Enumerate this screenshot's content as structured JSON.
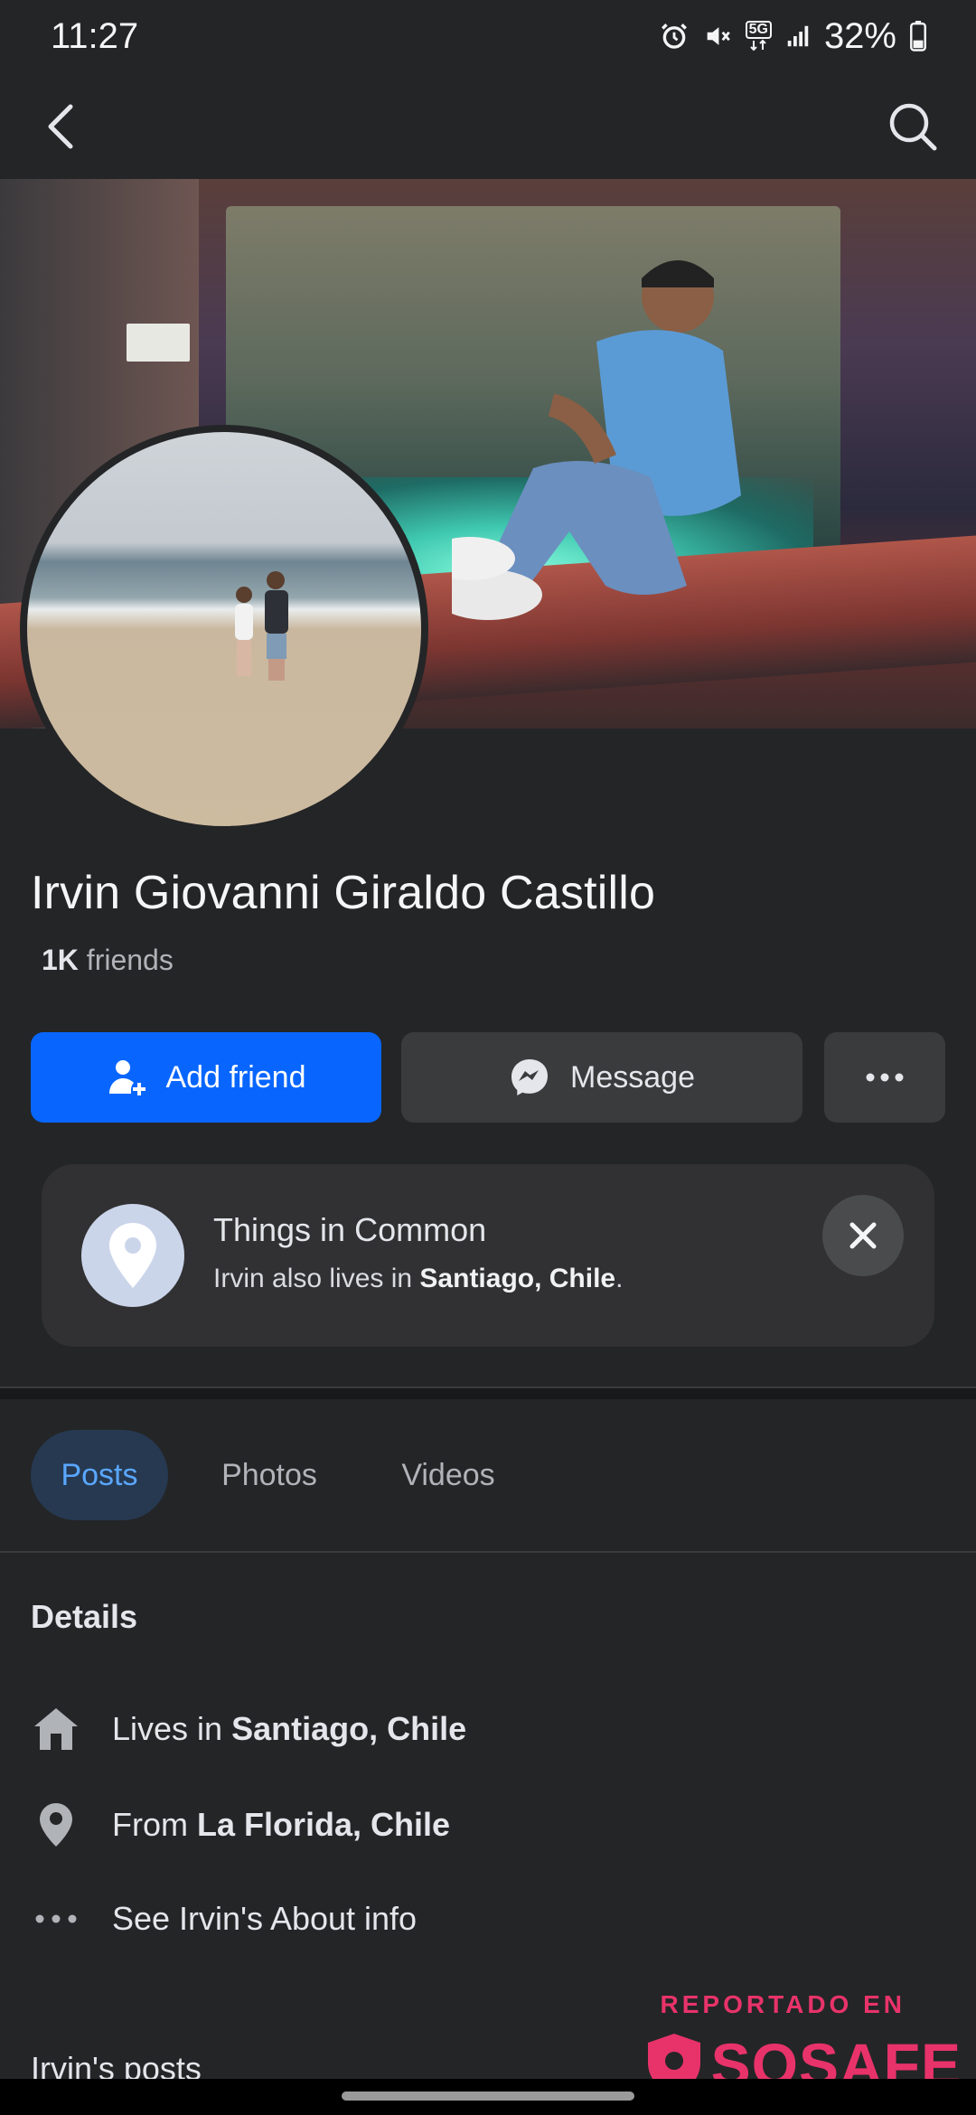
{
  "status_bar": {
    "time": "11:27",
    "network": "5G",
    "battery": "32%"
  },
  "nav": {
    "back_icon": "chevron-left-icon",
    "search_icon": "search-icon"
  },
  "profile": {
    "name": "Irvin Giovanni Giraldo Castillo",
    "friends_count": "1K",
    "friends_label": "friends"
  },
  "actions": {
    "add_friend": "Add friend",
    "message": "Message",
    "more_icon": "more-horizontal-icon"
  },
  "things_in_common": {
    "title": "Things in Common",
    "text_prefix": "Irvin also lives in ",
    "place": "Santiago, Chile",
    "text_suffix": "."
  },
  "tabs": [
    {
      "label": "Posts",
      "active": true
    },
    {
      "label": "Photos",
      "active": false
    },
    {
      "label": "Videos",
      "active": false
    }
  ],
  "details": {
    "heading": "Details",
    "lives_prefix": "Lives in ",
    "lives_place": "Santiago, Chile",
    "from_prefix": "From ",
    "from_place": "La Florida, Chile",
    "about_link": "See Irvin's About info"
  },
  "posts_heading": "Irvin's posts",
  "watermark": {
    "top": "REPORTADO EN",
    "brand": "SOSAFE"
  },
  "colors": {
    "background": "#242527",
    "primary_button": "#0866ff",
    "secondary_button": "#3a3b3c",
    "active_tab_bg": "#263951",
    "active_tab_text": "#5aa7ff",
    "watermark": "#e8336a"
  }
}
